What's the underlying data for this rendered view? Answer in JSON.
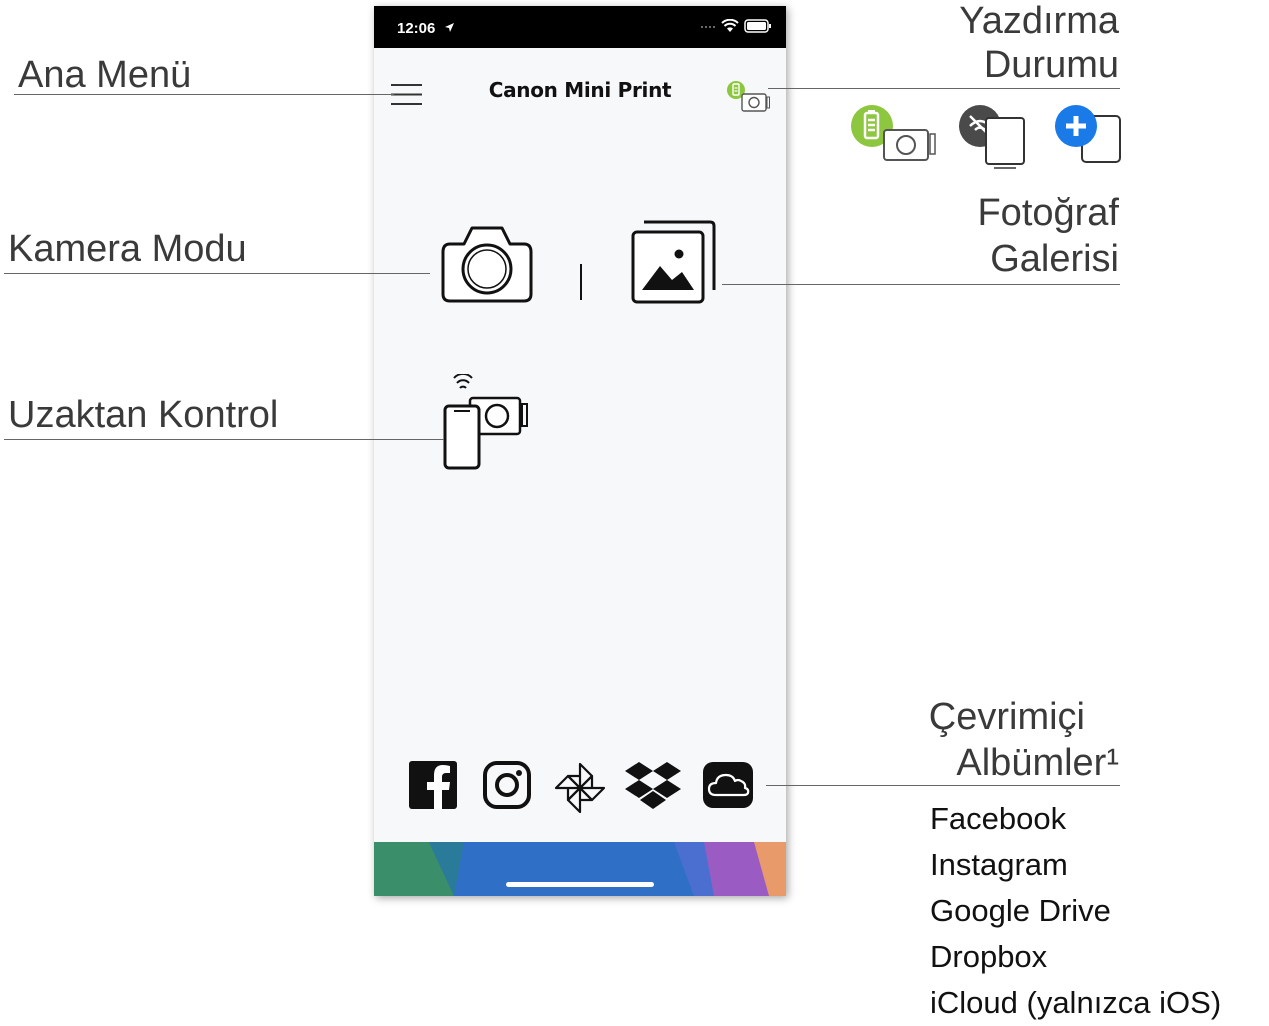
{
  "status_bar": {
    "time": "12:06"
  },
  "app": {
    "title": "Canon Mini Print"
  },
  "annotations": {
    "main_menu": "Ana Menü",
    "camera_mode": "Kamera Modu",
    "remote_control": "Uzaktan Kontrol",
    "print_status_line1": "Yazdırma",
    "print_status_line2": "Durumu",
    "photo_gallery_line1": "Fotoğraf",
    "photo_gallery_line2": "Galerisi",
    "online_albums_line1": "Çevrimiçi",
    "online_albums_line2": "Albümler¹"
  },
  "online_albums": [
    "Facebook",
    "Instagram",
    "Google Drive",
    "Dropbox",
    "iCloud (yalnızca iOS)"
  ],
  "printer_status_icons": [
    "battery-connected-icon",
    "disconnected-icon",
    "add-printer-icon"
  ],
  "colors": {
    "battery_green": "#8dc63f",
    "disconnected_dark": "#4a4a4a",
    "add_blue": "#1a7ae8",
    "gradient": [
      "#3a8f6a",
      "#2f6fc6",
      "#9a5cc2",
      "#e89a6a"
    ]
  }
}
